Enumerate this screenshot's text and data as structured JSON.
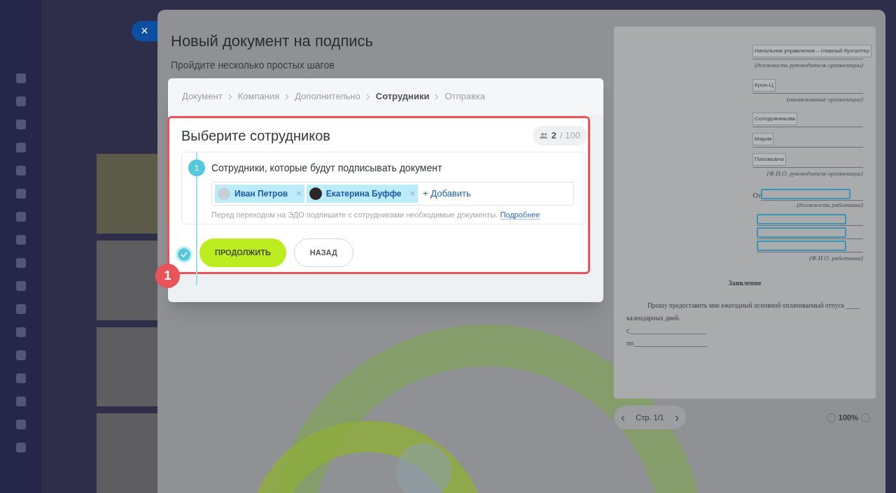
{
  "close_button": "×",
  "page": {
    "title": "Новый документ на подпись",
    "subtitle": "Пройдите несколько простых шагов"
  },
  "steps": [
    {
      "label": "Документ",
      "selected": false
    },
    {
      "label": "Компания",
      "selected": false
    },
    {
      "label": "Дополнительно",
      "selected": false
    },
    {
      "label": "Сотрудники",
      "selected": true
    },
    {
      "label": "Отправка",
      "selected": false
    }
  ],
  "section": {
    "title": "Выберите сотрудников",
    "counter": {
      "value": "2",
      "limit": "/ 100"
    }
  },
  "signers": {
    "number": "1",
    "label": "Сотрудники, которые будут подписывать документ",
    "chips": [
      {
        "name": "Иван Петров",
        "remove": "×"
      },
      {
        "name": "Екатерина Буффе",
        "remove": "×"
      }
    ],
    "add": "+ Добавить",
    "hint": "Перед переходом на ЭДО подпишите с сотрудниками необходимые документы.",
    "hint_link": "Подробнее"
  },
  "buttons": [
    {
      "kind": "primary",
      "label": "ПРОДОЛЖИТЬ"
    },
    {
      "kind": "secondary",
      "label": "НАЗАД"
    }
  ],
  "callout": "1",
  "document": {
    "header": [
      {
        "kind": "field",
        "text": "Начальник управления – главный бухгалтер"
      },
      {
        "kind": "caption",
        "text": "(должность руководителя организации)"
      },
      {
        "kind": "field",
        "text": "Крон-Ц"
      },
      {
        "kind": "caption",
        "text": "(наименование организации)"
      },
      {
        "kind": "field",
        "text": "Солодовникова"
      },
      {
        "kind": "field",
        "text": "Мария"
      },
      {
        "kind": "field",
        "text": "Пахомовна"
      },
      {
        "kind": "caption",
        "text": "(Ф.И.О. руководителя организации)"
      },
      {
        "kind": "from",
        "text": "От"
      },
      {
        "kind": "caption",
        "text": "(должность работника)"
      },
      {
        "kind": "empty"
      },
      {
        "kind": "empty"
      },
      {
        "kind": "empty"
      },
      {
        "kind": "caption",
        "text": "(Ф.И.О. работника)"
      }
    ],
    "heading": "Заявление",
    "body": "Прошу предоставить мне ежегодный основной оплачиваемый отпуск ____ календарных дней.",
    "date_lines": [
      "с______________________",
      "по_____________________"
    ]
  },
  "pager": {
    "prev": "‹",
    "label": "Стр. 1/1",
    "next": "›"
  },
  "zoom": {
    "level": "100%"
  }
}
